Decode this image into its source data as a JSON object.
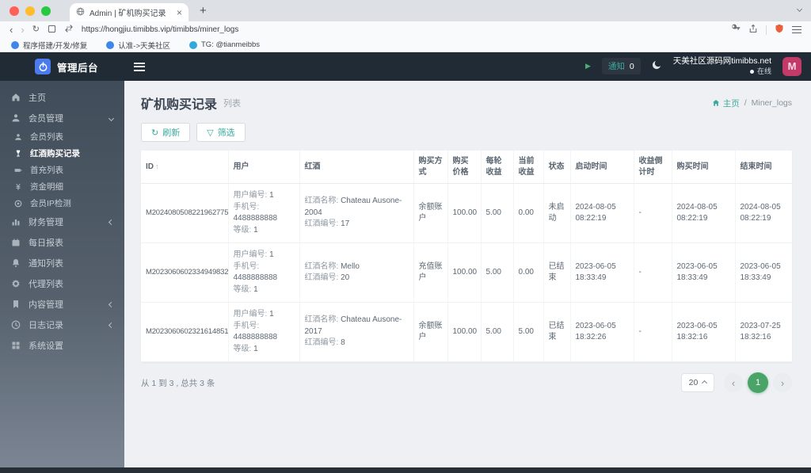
{
  "browser": {
    "tab_title": "Admin | 矿机购买记录",
    "url": "https://hongjiu.timibbs.vip/timibbs/miner_logs",
    "bookmarks": [
      "程序搭建/开发/修复",
      "认准->天美社区",
      "TG: @tianmeibbs"
    ]
  },
  "header": {
    "brand": "管理后台",
    "notice_label": "通知",
    "notice_count": "0",
    "site_name": "天美社区源码网timibbs.net",
    "online_status": "在线",
    "avatar_text": "M"
  },
  "sidebar": {
    "items": [
      {
        "key": "home",
        "icon": "home",
        "label": "主页"
      },
      {
        "key": "member-mgmt",
        "icon": "user",
        "label": "会员管理",
        "chevron": "down"
      },
      {
        "key": "member-list",
        "icon": "user",
        "label": "会员列表",
        "sub": true
      },
      {
        "key": "wine-purchase-logs",
        "icon": "wine",
        "label": "红酒购买记录",
        "sub": true,
        "active": true
      },
      {
        "key": "first-charge-list",
        "icon": "battery",
        "label": "首充列表",
        "sub": true
      },
      {
        "key": "fund-detail",
        "icon": "money",
        "label": "资金明细",
        "sub": true
      },
      {
        "key": "member-ip-check",
        "icon": "target",
        "label": "会员IP检测",
        "sub": true
      },
      {
        "key": "finance-mgmt",
        "icon": "chart",
        "label": "财务管理",
        "chevron": "left"
      },
      {
        "key": "daily-report",
        "icon": "calendar",
        "label": "每日报表"
      },
      {
        "key": "notice-list",
        "icon": "bell",
        "label": "通知列表"
      },
      {
        "key": "agent-list",
        "icon": "gear",
        "label": "代理列表"
      },
      {
        "key": "content-mgmt",
        "icon": "bookmark",
        "label": "内容管理",
        "chevron": "left"
      },
      {
        "key": "log-record",
        "icon": "clock",
        "label": "日志记录",
        "chevron": "left"
      },
      {
        "key": "system-settings",
        "icon": "grid",
        "label": "系统设置"
      }
    ]
  },
  "page": {
    "title": "矿机购买记录",
    "subtitle": "列表",
    "breadcrumb_home": "主页",
    "breadcrumb_current": "Miner_logs",
    "refresh_label": "刷新",
    "filter_label": "筛选"
  },
  "table": {
    "columns": [
      {
        "key": "id",
        "label": "ID",
        "sortable": true
      },
      {
        "key": "user",
        "label": "用户"
      },
      {
        "key": "wine",
        "label": "红酒"
      },
      {
        "key": "pay_method",
        "label": "购买方式"
      },
      {
        "key": "price",
        "label": "购买价格"
      },
      {
        "key": "round_profit",
        "label": "每轮收益"
      },
      {
        "key": "current_profit",
        "label": "当前收益"
      },
      {
        "key": "status",
        "label": "状态"
      },
      {
        "key": "start_time",
        "label": "启动时间"
      },
      {
        "key": "countdown",
        "label": "收益倒计时"
      },
      {
        "key": "buy_time",
        "label": "购买时间"
      },
      {
        "key": "end_time",
        "label": "结束时间"
      }
    ],
    "rows": [
      {
        "id": "M2024080508221962775",
        "user": {
          "no_label": "用户编号:",
          "no": "1",
          "phone_label": "手机号:",
          "phone": "4488888888",
          "level_label": "等级:",
          "level": "1"
        },
        "wine": {
          "name_label": "红酒名称:",
          "name": "Chateau Ausone-2004",
          "no_label": "红酒编号:",
          "no": "17"
        },
        "pay_method": "余额账户",
        "price": "100.00",
        "round_profit": "5.00",
        "current_profit": "0.00",
        "status": "未启动",
        "start_time": "2024-08-05 08:22:19",
        "countdown": "-",
        "buy_time": "2024-08-05 08:22:19",
        "end_time": "2024-08-05 08:22:19"
      },
      {
        "id": "M2023060602334949832",
        "user": {
          "no_label": "用户编号:",
          "no": "1",
          "phone_label": "手机号:",
          "phone": "4488888888",
          "level_label": "等级:",
          "level": "1"
        },
        "wine": {
          "name_label": "红酒名称:",
          "name": "Mello",
          "no_label": "红酒编号:",
          "no": "20"
        },
        "pay_method": "充值账户",
        "price": "100.00",
        "round_profit": "5.00",
        "current_profit": "0.00",
        "status": "已结束",
        "start_time": "2023-06-05 18:33:49",
        "countdown": "-",
        "buy_time": "2023-06-05 18:33:49",
        "end_time": "2023-06-05 18:33:49"
      },
      {
        "id": "M2023060602321614851",
        "user": {
          "no_label": "用户编号:",
          "no": "1",
          "phone_label": "手机号:",
          "phone": "4488888888",
          "level_label": "等级:",
          "level": "1"
        },
        "wine": {
          "name_label": "红酒名称:",
          "name": "Chateau Ausone-2017",
          "no_label": "红酒编号:",
          "no": "8"
        },
        "pay_method": "余额账户",
        "price": "100.00",
        "round_profit": "5.00",
        "current_profit": "5.00",
        "status": "已结束",
        "start_time": "2023-06-05 18:32:26",
        "countdown": "-",
        "buy_time": "2023-06-05 18:32:16",
        "end_time": "2023-07-25 18:32:16"
      }
    ]
  },
  "footer": {
    "summary": "从 1 到 3 , 总共 3 条",
    "page_size": "20",
    "current_page": "1"
  },
  "colors": {
    "accent_teal": "#3BA99C",
    "pagination_green": "#4AA468",
    "header_bg": "#212B36",
    "sidebar_top": "#404C59",
    "sidebar_bottom": "#7B8594",
    "logo_blue": "#4B7BEC",
    "avatar_pink": "#C23A67",
    "shield_orange": "#E8613C"
  }
}
